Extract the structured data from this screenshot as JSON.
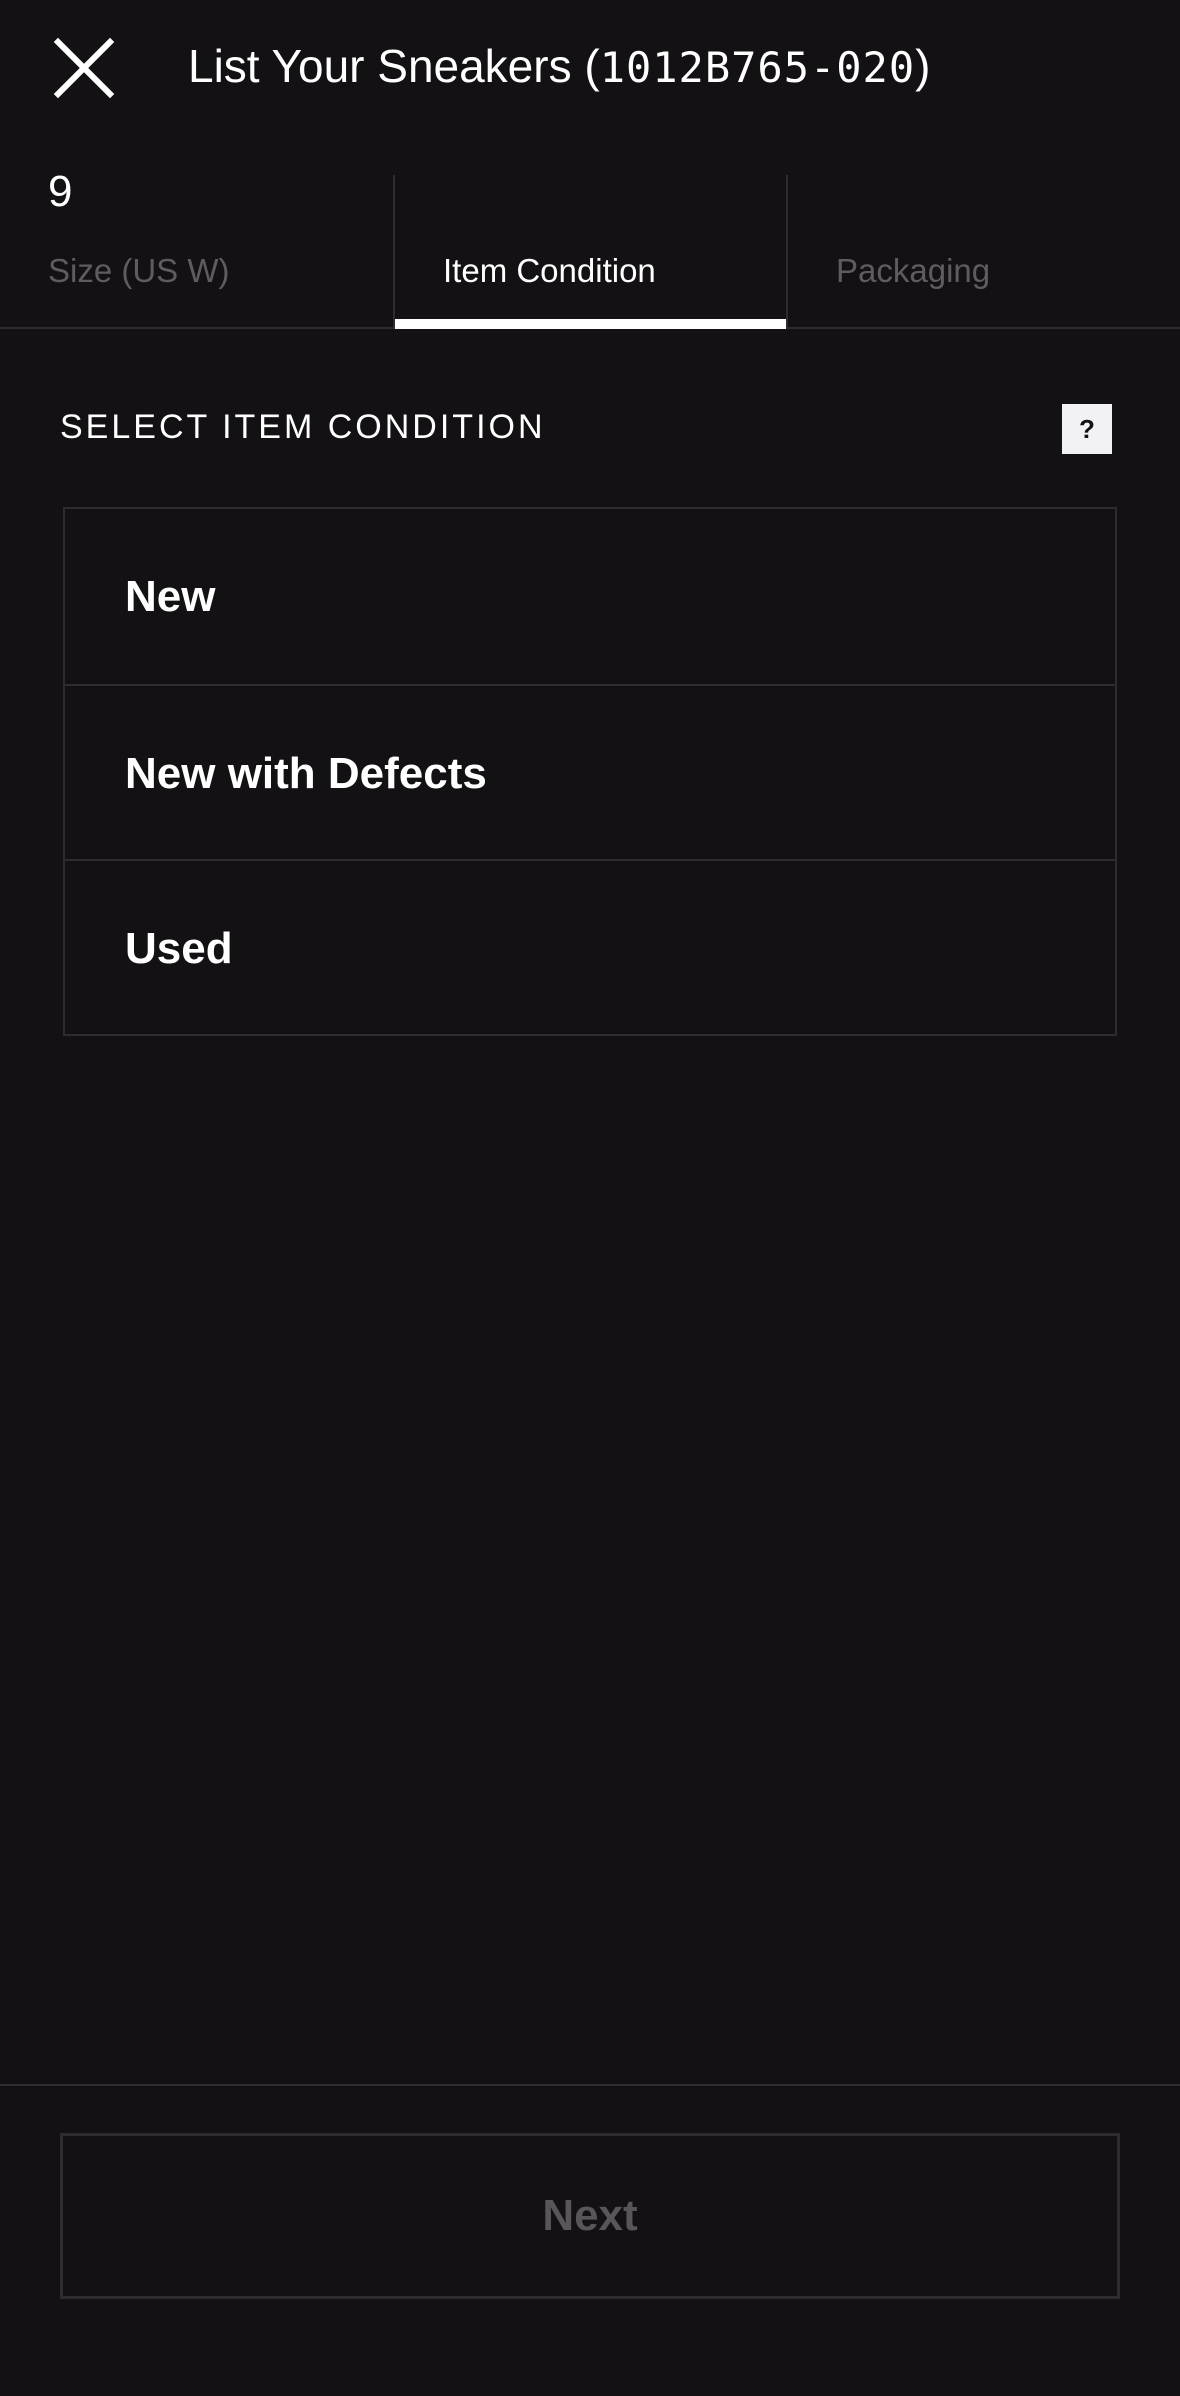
{
  "header": {
    "close_icon": "close-icon",
    "title_text": "List Your Sneakers (",
    "style_code": "1012B765-020",
    "title_suffix": ")"
  },
  "tabs": [
    {
      "value": "9",
      "label": "Size (US W)",
      "state": "completed"
    },
    {
      "value": "",
      "label": "Item Condition",
      "state": "active"
    },
    {
      "value": "",
      "label": "Packaging",
      "state": "pending"
    }
  ],
  "section": {
    "title": "SELECT ITEM CONDITION",
    "help_label": "?"
  },
  "options": [
    {
      "label": "New"
    },
    {
      "label": "New with Defects"
    },
    {
      "label": "Used"
    }
  ],
  "footer": {
    "next_label": "Next",
    "next_enabled": false
  },
  "colors": {
    "background": "#131114",
    "border": "#2e2c30",
    "text": "#ffffff",
    "muted_text": "#5e5c61",
    "disabled_text": "#58565b"
  }
}
